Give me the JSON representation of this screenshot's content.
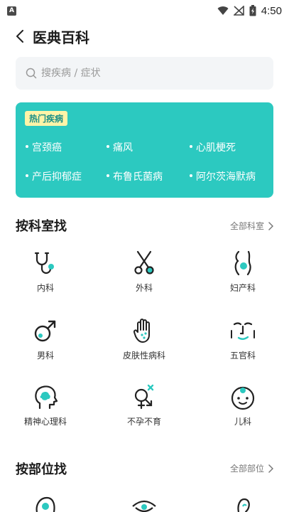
{
  "status": {
    "time": "4:50",
    "app_badge": "A"
  },
  "header": {
    "title": "医典百科"
  },
  "search": {
    "placeholder": "搜疾病 / 症状"
  },
  "hot": {
    "tag": "热门疾病",
    "items": [
      {
        "label": "宫颈癌"
      },
      {
        "label": "痛风"
      },
      {
        "label": "心肌梗死"
      },
      {
        "label": "产后抑郁症"
      },
      {
        "label": "布鲁氏菌病"
      },
      {
        "label": "阿尔茨海默病"
      }
    ]
  },
  "dept_section": {
    "title": "按科室找",
    "more": "全部科室",
    "items": [
      {
        "label": "内科",
        "icon": "stethoscope-icon"
      },
      {
        "label": "外科",
        "icon": "scissors-icon"
      },
      {
        "label": "妇产科",
        "icon": "pregnancy-icon"
      },
      {
        "label": "男科",
        "icon": "male-symbol-icon"
      },
      {
        "label": "皮肤性病科",
        "icon": "hand-skin-icon"
      },
      {
        "label": "五官科",
        "icon": "face-icon"
      },
      {
        "label": "精神心理科",
        "icon": "head-brain-icon"
      },
      {
        "label": "不孕不育",
        "icon": "infertility-icon"
      },
      {
        "label": "儿科",
        "icon": "baby-face-icon"
      }
    ]
  },
  "body_section": {
    "title": "按部位找",
    "more": "全部部位"
  },
  "colors": {
    "accent": "#2cc9c0",
    "tag_bg": "#fff4a8"
  }
}
